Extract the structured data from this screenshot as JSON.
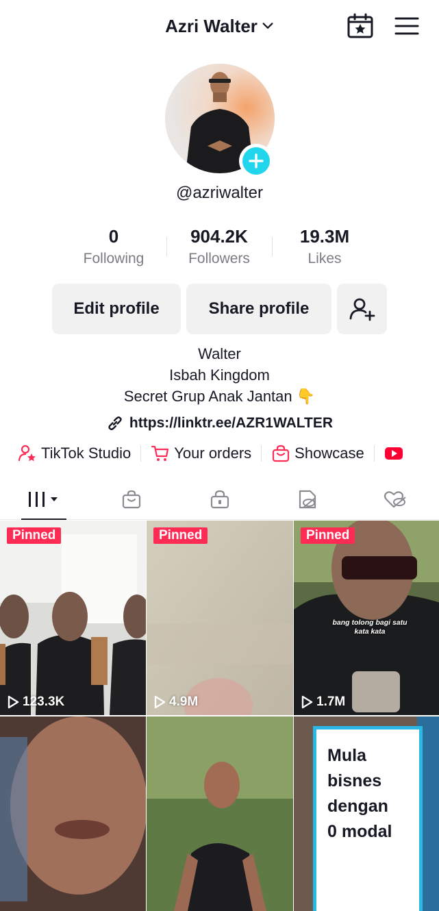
{
  "header": {
    "title": "Azri Walter"
  },
  "profile": {
    "username": "@azriwalter"
  },
  "stats": [
    {
      "value": "0",
      "label": "Following"
    },
    {
      "value": "904.2K",
      "label": "Followers"
    },
    {
      "value": "19.3M",
      "label": "Likes"
    }
  ],
  "buttons": {
    "edit": "Edit profile",
    "share": "Share profile"
  },
  "bio": {
    "line1": "Walter",
    "line2": "Isbah Kingdom",
    "line3": "Secret Grup Anak Jantan 👇"
  },
  "link": "https://linktr.ee/AZR1WALTER",
  "shortcuts": [
    {
      "label": "TikTok Studio",
      "icon": "person-star-icon"
    },
    {
      "label": "Your orders",
      "icon": "cart-icon"
    },
    {
      "label": "Showcase",
      "icon": "shopping-bag-icon"
    }
  ],
  "tabs": [
    {
      "icon": "videos-grid-icon"
    },
    {
      "icon": "shop-bag-icon"
    },
    {
      "icon": "lock-bag-icon"
    },
    {
      "icon": "reposts-hidden-icon"
    },
    {
      "icon": "liked-hidden-icon"
    }
  ],
  "videos": [
    {
      "pinned": "Pinned",
      "views": "123.3K"
    },
    {
      "pinned": "Pinned",
      "views": "4.9M"
    },
    {
      "pinned": "Pinned",
      "views": "1.7M",
      "caption": "bang tolong bagi satu kata kata"
    },
    {
      "views": ""
    },
    {
      "views": ""
    },
    {
      "views": "",
      "card_text": "Mula bisnes dengan 0 modal"
    }
  ],
  "colors": {
    "accent": "#fe2c55",
    "badge": "#20d5ec",
    "card_border": "#2ab7e6"
  }
}
